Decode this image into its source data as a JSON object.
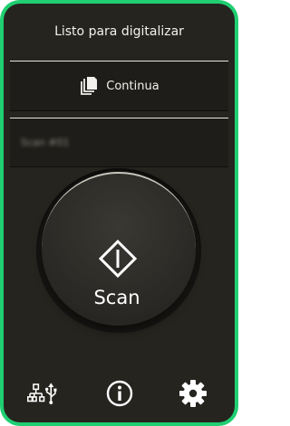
{
  "status": {
    "text": "Listo para digitalizar"
  },
  "mode": {
    "label": "Continua",
    "icon": "stacked-pages-icon"
  },
  "profile": {
    "text": "Scan #01"
  },
  "scan_button": {
    "label": "Scan",
    "icon": "diamond-bar-icon"
  },
  "bottom_bar": {
    "icons": [
      "network-usb-icon",
      "info-icon",
      "gear-icon"
    ]
  },
  "colors": {
    "frame": "#1fcf72",
    "panel": "#26241f",
    "text": "#f2f1ec"
  }
}
